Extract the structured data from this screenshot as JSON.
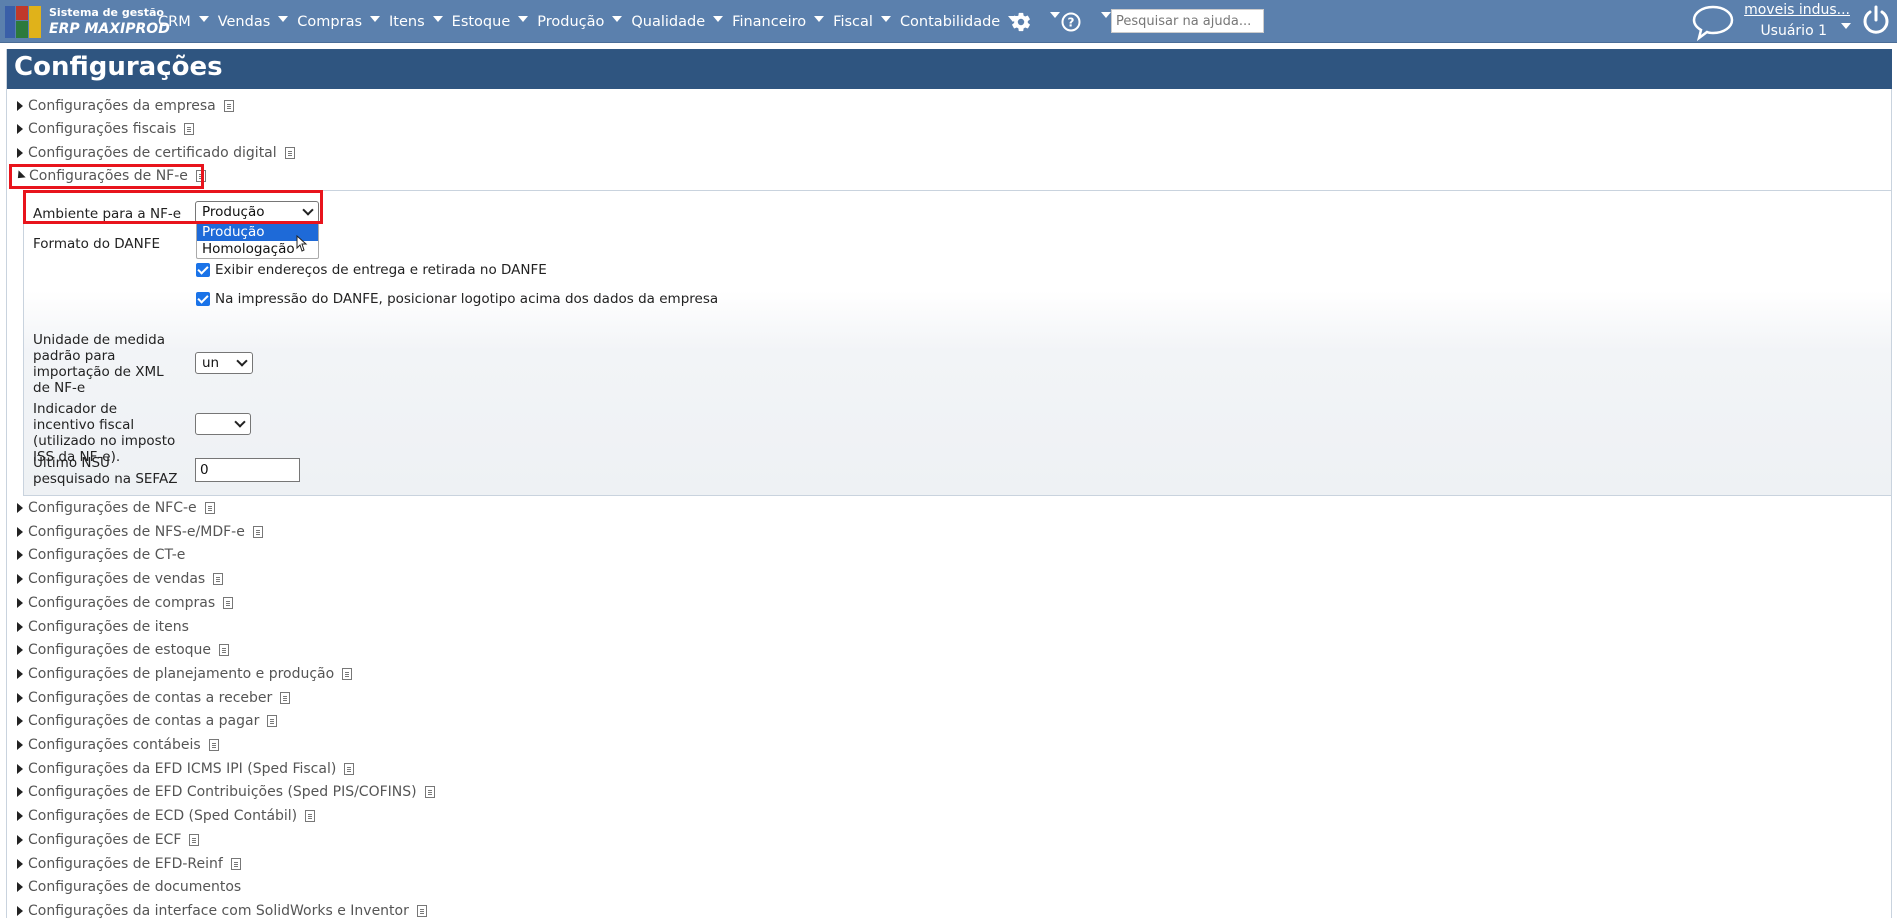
{
  "app": {
    "logo_line1": "Sistema de gestão",
    "logo_line2": "ERP MAXIPROD"
  },
  "menu": [
    {
      "label": "CRM"
    },
    {
      "label": "Vendas"
    },
    {
      "label": "Compras"
    },
    {
      "label": "Itens"
    },
    {
      "label": "Estoque"
    },
    {
      "label": "Produção"
    },
    {
      "label": "Qualidade"
    },
    {
      "label": "Financeiro"
    },
    {
      "label": "Fiscal"
    },
    {
      "label": "Contabilidade"
    }
  ],
  "search": {
    "placeholder": "Pesquisar na ajuda..."
  },
  "user": {
    "company": "moveis indus...",
    "name": "Usuário 1"
  },
  "page": {
    "title": "Configurações"
  },
  "sections_top": [
    {
      "label": "Configurações da empresa",
      "doc": true
    },
    {
      "label": "Configurações fiscais",
      "doc": true
    },
    {
      "label": "Configurações de certificado digital",
      "doc": true
    }
  ],
  "nfe_section": {
    "label": "Configurações de NF-e"
  },
  "nfe_form": {
    "ambiente_label": "Ambiente para a NF-e",
    "ambiente_value": "Produção",
    "ambiente_options": [
      "Produção",
      "Homologação"
    ],
    "formato_label": "Formato do DANFE",
    "check1_label": "Exibir endereços de entrega e retirada no DANFE",
    "check2_label": "Na impressão do DANFE, posicionar logotipo acima dos dados da empresa",
    "unidade_label": "Unidade de medida padrão para importação de XML de NF-e",
    "unidade_value": "un",
    "indicador_label": "Indicador de incentivo fiscal (utilizado no imposto ISS da NF-e).",
    "indicador_value": "",
    "nsu_label": "Último NSU pesquisado na SEFAZ",
    "nsu_value": "0"
  },
  "sections_bottom": [
    {
      "label": "Configurações de NFC-e",
      "doc": true
    },
    {
      "label": "Configurações de NFS-e/MDF-e",
      "doc": true
    },
    {
      "label": "Configurações de CT-e",
      "doc": false
    },
    {
      "label": "Configurações de vendas",
      "doc": true
    },
    {
      "label": "Configurações de compras",
      "doc": true
    },
    {
      "label": "Configurações de itens",
      "doc": false
    },
    {
      "label": "Configurações de estoque",
      "doc": true
    },
    {
      "label": "Configurações de planejamento e produção",
      "doc": true
    },
    {
      "label": "Configurações de contas a receber",
      "doc": true
    },
    {
      "label": "Configurações de contas a pagar",
      "doc": true
    },
    {
      "label": "Configurações contábeis",
      "doc": true
    },
    {
      "label": "Configurações da EFD ICMS IPI (Sped Fiscal)",
      "doc": true
    },
    {
      "label": "Configurações de EFD Contribuições (Sped PIS/COFINS)",
      "doc": true
    },
    {
      "label": "Configurações de ECD (Sped Contábil)",
      "doc": true
    },
    {
      "label": "Configurações de ECF",
      "doc": true
    },
    {
      "label": "Configurações de EFD-Reinf",
      "doc": true
    },
    {
      "label": "Configurações de documentos",
      "doc": false
    },
    {
      "label": "Configurações da interface com SolidWorks e Inventor",
      "doc": true
    }
  ],
  "colors": {
    "topbar": "#5b80ad",
    "header": "#2f5580",
    "highlight": "#e8141c",
    "selected_option": "#1e6ad8"
  }
}
